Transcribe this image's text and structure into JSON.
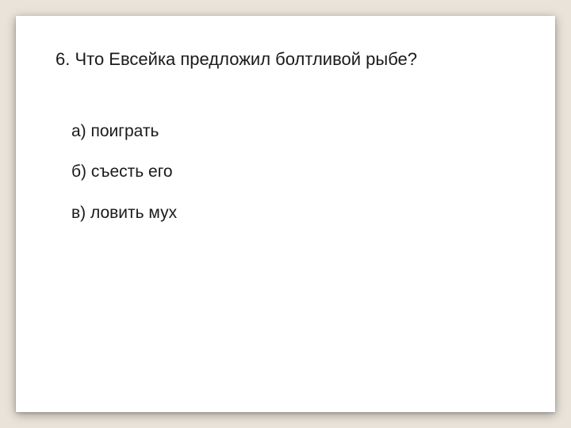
{
  "question": "6. Что Евсейка предложил болтливой рыбе?",
  "answers": [
    "а) поиграть",
    "б) съесть его",
    "в) ловить мух"
  ]
}
